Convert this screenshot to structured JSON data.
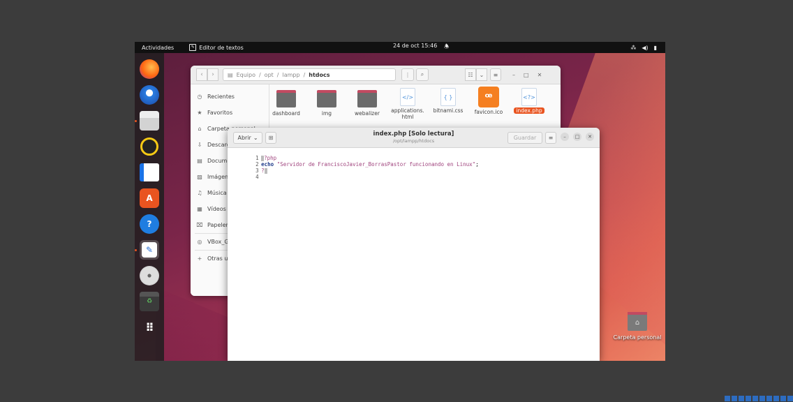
{
  "topbar": {
    "activities": "Actividades",
    "app_name": "Editor de textos",
    "clock": "24 de oct 15:46"
  },
  "dock": {
    "items": [
      "firefox",
      "thunderbird",
      "files",
      "rhythmbox",
      "libreoffice-writer",
      "ubuntu-software",
      "help",
      "text-editor",
      "disc",
      "trash",
      "show-applications"
    ]
  },
  "file_manager": {
    "path": [
      "Equipo",
      "opt",
      "lampp",
      "htdocs"
    ],
    "sidebar": [
      "Recientes",
      "Favoritos",
      "Carpeta personal",
      "Descargas",
      "Documentos",
      "Imágenes",
      "Música",
      "Vídeos",
      "Papelera",
      "VBox_G",
      "Otras ubicaciones"
    ],
    "files": [
      {
        "name": "dashboard",
        "kind": "folder"
      },
      {
        "name": "img",
        "kind": "folder"
      },
      {
        "name": "webalizer",
        "kind": "folder"
      },
      {
        "name": "applications.html",
        "kind": "html"
      },
      {
        "name": "bitnami.css",
        "kind": "css"
      },
      {
        "name": "favicon.ico",
        "kind": "xampp"
      },
      {
        "name": "index.php",
        "kind": "php",
        "selected": true
      }
    ]
  },
  "editor": {
    "open_label": "Abrir",
    "title": "index.php [Solo lectura]",
    "subtitle": "/opt/lampp/htdocs",
    "save_label": "Guardar",
    "lines": [
      {
        "num": "1",
        "text": "?php"
      },
      {
        "num": "2",
        "keyword": "echo",
        "string": "\"Servidor de FranciscoJavier_BorrasPastor funcionando en Linux\"",
        "end": ";"
      },
      {
        "num": "3",
        "text": "?"
      },
      {
        "num": "4",
        "text": ""
      }
    ]
  },
  "desktop": {
    "home_label": "Carpeta personal"
  },
  "colors": {
    "accent": "#e95420",
    "topbar": "#111111"
  }
}
